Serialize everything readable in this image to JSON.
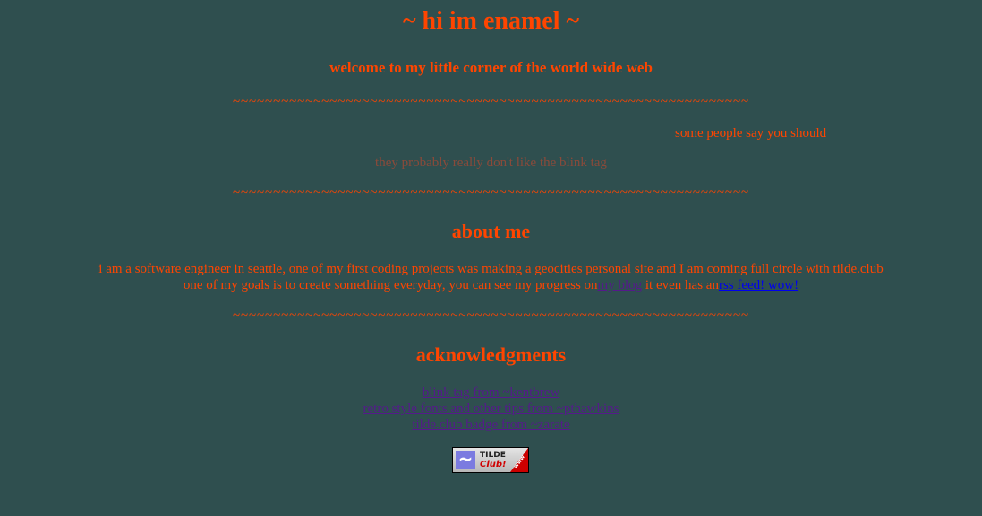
{
  "header": {
    "title": "~ hi im enamel ~",
    "welcome": "welcome to my little corner of the world wide web"
  },
  "divider": "~~~~~~~~~~~~~~~~~~~~~~~~~~~~~~~~~~~~~~~~~~~~~~~~~~~~~~~~~~~~~~~~",
  "marquee_text": "some people say you should",
  "blink_text": "they probably really don't like the blink tag",
  "about": {
    "heading": "about me",
    "line1": "i am a software engineer in seattle, one of my first coding projects was making a geocities personal site and I am coming full circle with tilde.club",
    "line2_prefix": "one of my goals is to create something everyday, you can see my progress on",
    "blog_link": "my blog",
    "line2_middle": "it even has an",
    "rss_link": "rss feed! wow!"
  },
  "acknowledgments": {
    "heading": "acknowledgments",
    "links": [
      "blink tag from ~kentbrew",
      "retro style fonts and other tips from ~pthawkins",
      "tilde.club badge from ~zarate"
    ]
  },
  "badge": {
    "icon": "tilde-icon",
    "line1": "TILDE",
    "line2": "Club!",
    "corner": "www"
  },
  "colors": {
    "background": "#2f4f4f",
    "text": "#ff4500",
    "visited_link": "#551a8b",
    "link": "#0000ee",
    "blink_text": "#8a4a3a"
  }
}
